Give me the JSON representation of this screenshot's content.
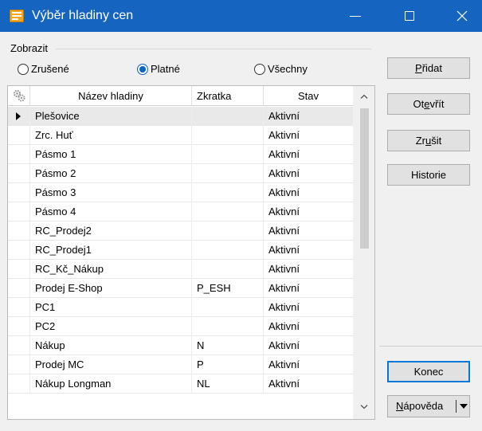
{
  "window": {
    "title": "Výběr hladiny cen",
    "colors": {
      "titlebar": "#1565c0",
      "radio_accent": "#0a64c8",
      "default_button_border": "#0078d7"
    }
  },
  "filter": {
    "group_label": "Zobrazit",
    "options": [
      "Zrušené",
      "Platné",
      "Všechny"
    ],
    "selected": "Platné"
  },
  "grid": {
    "columns": [
      "Název hladiny",
      "Zkratka",
      "Stav"
    ],
    "selected_row": 0,
    "rows": [
      {
        "name": "Plešovice",
        "abbr": "",
        "state": "Aktivní"
      },
      {
        "name": "Zrc. Huť",
        "abbr": "",
        "state": "Aktivní"
      },
      {
        "name": "Pásmo 1",
        "abbr": "",
        "state": "Aktivní"
      },
      {
        "name": "Pásmo 2",
        "abbr": "",
        "state": "Aktivní"
      },
      {
        "name": "Pásmo 3",
        "abbr": "",
        "state": "Aktivní"
      },
      {
        "name": "Pásmo 4",
        "abbr": "",
        "state": "Aktivní"
      },
      {
        "name": "RC_Prodej2",
        "abbr": "",
        "state": "Aktivní"
      },
      {
        "name": "RC_Prodej1",
        "abbr": "",
        "state": "Aktivní"
      },
      {
        "name": "RC_Kč_Nákup",
        "abbr": "",
        "state": "Aktivní"
      },
      {
        "name": "Prodej E-Shop",
        "abbr": "P_ESH",
        "state": "Aktivní"
      },
      {
        "name": "PC1",
        "abbr": "",
        "state": "Aktivní"
      },
      {
        "name": "PC2",
        "abbr": "",
        "state": "Aktivní"
      },
      {
        "name": "Nákup",
        "abbr": "N",
        "state": "Aktivní"
      },
      {
        "name": "Prodej MC",
        "abbr": "P",
        "state": "Aktivní"
      },
      {
        "name": "Nákup Longman",
        "abbr": "NL",
        "state": "Aktivní"
      }
    ]
  },
  "buttons": {
    "add": {
      "mnemonic": "P",
      "rest": "řidat"
    },
    "open": {
      "pre": "Ot",
      "mnemonic": "e",
      "rest": "vřít"
    },
    "cancel": {
      "pre": "Zr",
      "mnemonic": "u",
      "rest": "šit"
    },
    "history": "Historie",
    "close": "Konec",
    "help": {
      "mnemonic": "N",
      "rest": "ápověda"
    }
  }
}
